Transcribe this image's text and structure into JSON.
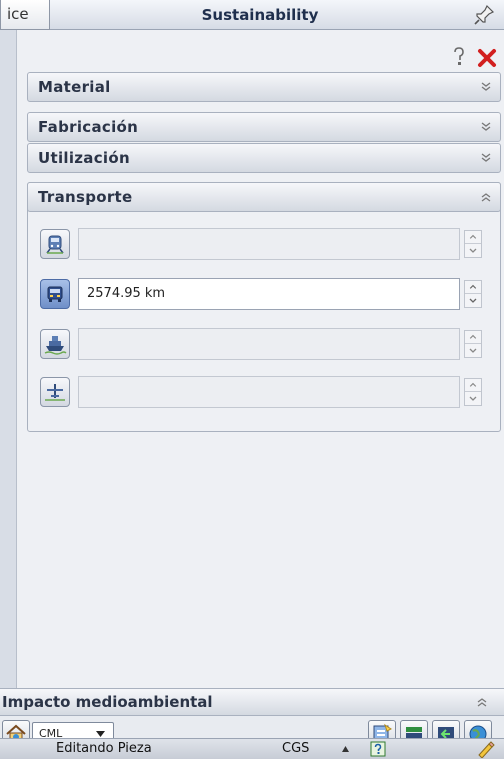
{
  "window": {
    "left_tab_label": "ice",
    "title": "Sustainability"
  },
  "sections": {
    "material": "Material",
    "fabricacion": "Fabricación",
    "utilizacion": "Utilización",
    "transporte": "Transporte"
  },
  "transport": {
    "rows": [
      {
        "icon": "train-icon",
        "value": "",
        "active": false
      },
      {
        "icon": "truck-icon",
        "value": "2574.95 km",
        "active": true
      },
      {
        "icon": "ship-icon",
        "value": "",
        "active": false
      },
      {
        "icon": "airplane-icon",
        "value": "",
        "active": false
      }
    ]
  },
  "impact": {
    "title": "Impacto medioambiental",
    "method_selected": "CML"
  },
  "statusbar": {
    "text": "Editando Pieza",
    "units": "CGS"
  },
  "colors": {
    "close_red": "#d21f1f",
    "active_icon_blue": "#6f8fc8",
    "title_text": "#1f2f4d"
  }
}
